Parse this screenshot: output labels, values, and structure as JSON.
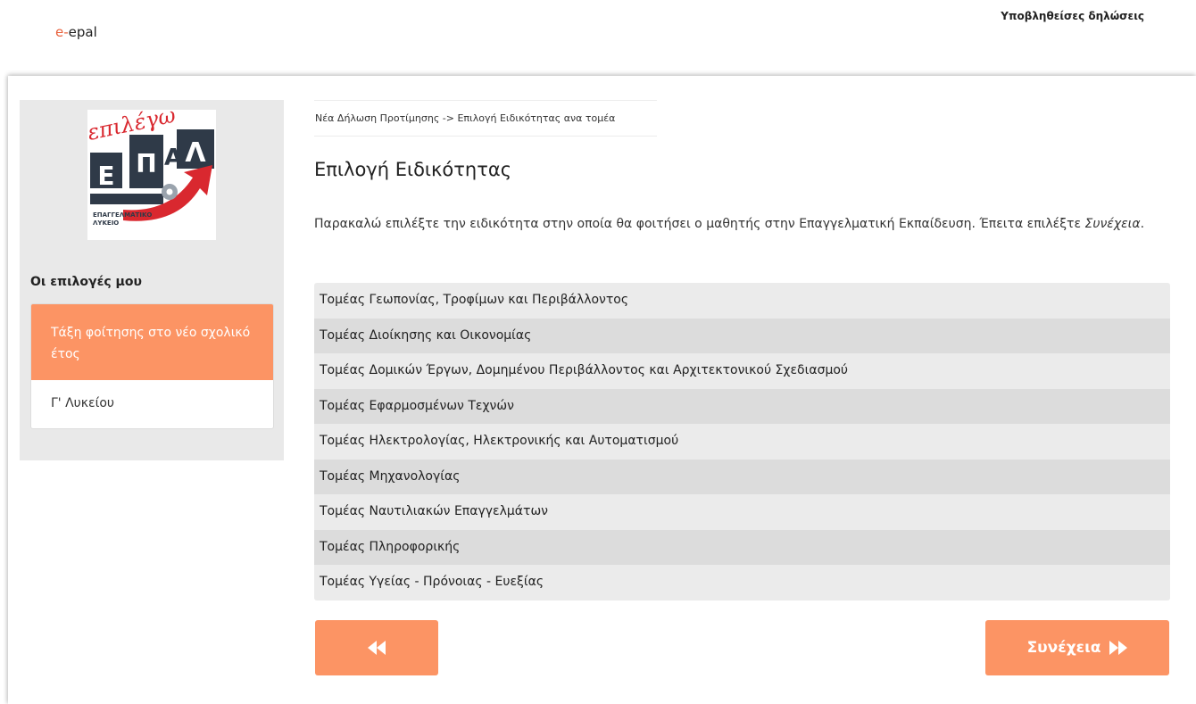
{
  "header": {
    "brand_prefix": "e-",
    "brand_name": "epal",
    "nav_link": "Υποβληθείσες δηλώσεις"
  },
  "sidebar": {
    "logo": {
      "script_text": "επιλέγω",
      "letters": "ΕΠΑΛ",
      "caption_line1": "ΕΠΑΓΓΕΛΜΑΤΙΚΟ",
      "caption_line2": "ΛΥΚΕΙΟ"
    },
    "heading": "Οι επιλογές μου",
    "choice_header": "Τάξη φοίτησης στο νέο σχολικό έτος",
    "choice_value": "Γ' Λυκείου"
  },
  "main": {
    "breadcrumb": "Νέα Δήλωση Προτίμησης -> Επιλογή Ειδικότητας ανα τομέα",
    "title": "Επιλογή Ειδικότητας",
    "instructions_main": "Παρακαλώ επιλέξτε την ειδικότητα στην οποία θα φοιτήσει ο μαθητής στην Επαγγελματική Εκπαίδευση. Έπειτα επιλέξτε ",
    "instructions_emph": "Συνέχεια",
    "instructions_end": ".",
    "sectors": [
      "Τομέας Γεωπονίας, Τροφίμων και Περιβάλλοντος",
      "Τομέας Διοίκησης και Οικονομίας",
      "Τομέας Δομικών Έργων, Δομημένου Περιβάλλοντος και Αρχιτεκτονικού Σχεδιασμού",
      "Τομέας Εφαρμοσμένων Τεχνών",
      "Τομέας Ηλεκτρολογίας, Ηλεκτρονικής και Αυτοματισμού",
      "Τομέας Μηχανολογίας",
      "Τομέας Ναυτιλιακών Επαγγελμάτων",
      "Τομέας Πληροφορικής",
      "Τομέας Υγείας - Πρόνοιας - Ευεξίας"
    ]
  },
  "buttons": {
    "next_label": "Συνέχεια",
    "back_icon": "fast-backward-icon",
    "next_icon": "fast-forward-icon"
  },
  "colors": {
    "accent": "#fc9464",
    "brand_red": "#e8613c",
    "sidebar_bg": "#e9e9e9"
  }
}
